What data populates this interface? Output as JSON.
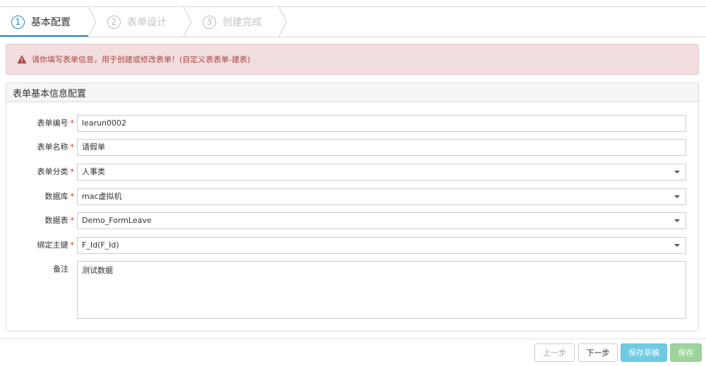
{
  "wizard": {
    "steps": [
      {
        "number": "1",
        "label": "基本配置"
      },
      {
        "number": "2",
        "label": "表单设计"
      },
      {
        "number": "3",
        "label": "创建完成"
      }
    ]
  },
  "alert": {
    "message": "请你填写表单信息，用于创建或修改表单！(自定义表表单-建表)"
  },
  "panel": {
    "title": "表单基本信息配置"
  },
  "form": {
    "fields": [
      {
        "label": "表单编号",
        "value": "learun0002",
        "type": "text",
        "required": true
      },
      {
        "label": "表单名称",
        "value": "请假单",
        "type": "text",
        "required": true
      },
      {
        "label": "表单分类",
        "value": "人事类",
        "type": "select",
        "required": true
      },
      {
        "label": "数据库",
        "value": "mac虚拟机",
        "type": "select",
        "required": true
      },
      {
        "label": "数据表",
        "value": "Demo_FormLeave",
        "type": "select",
        "required": true
      },
      {
        "label": "绑定主键",
        "value": "F_Id(F_Id)",
        "type": "select",
        "required": true
      }
    ],
    "remark": {
      "label": "备注",
      "value": "测试数据"
    },
    "required_mark": "*"
  },
  "footer": {
    "prev_label": "上一步",
    "next_label": "下一步",
    "draft_label": "保存草稿",
    "save_label": "保存"
  },
  "colors": {
    "accent": "#2a84c9",
    "alert_text": "#a94442",
    "alert_bg": "#f2dede",
    "required": "#e02222",
    "info_button": "#5bc0de",
    "success_button": "#5cb85c"
  },
  "icons": {
    "alert": "warning-triangle-icon",
    "select": "caret-down-icon"
  }
}
